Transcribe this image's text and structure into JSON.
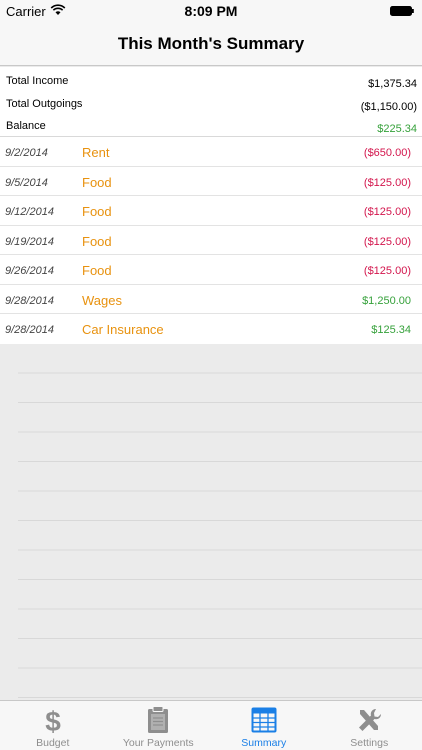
{
  "status_bar": {
    "carrier": "Carrier",
    "time": "8:09 PM"
  },
  "nav": {
    "title": "This Month's Summary"
  },
  "summary": {
    "rows": [
      {
        "label": "Total Income",
        "value": "$1,375.34",
        "color": "#000000"
      },
      {
        "label": "Total Outgoings",
        "value": "($1,150.00)",
        "color": "#000000"
      },
      {
        "label": "Balance",
        "value": "$225.34",
        "color": "#36a13b"
      }
    ]
  },
  "transactions": [
    {
      "date": "9/2/2014",
      "description": "Rent",
      "amount": "($650.00)",
      "type": "outgoing"
    },
    {
      "date": "9/5/2014",
      "description": "Food",
      "amount": "($125.00)",
      "type": "outgoing"
    },
    {
      "date": "9/12/2014",
      "description": "Food",
      "amount": "($125.00)",
      "type": "outgoing"
    },
    {
      "date": "9/19/2014",
      "description": "Food",
      "amount": "($125.00)",
      "type": "outgoing"
    },
    {
      "date": "9/26/2014",
      "description": "Food",
      "amount": "($125.00)",
      "type": "outgoing"
    },
    {
      "date": "9/28/2014",
      "description": "Wages",
      "amount": "$1,250.00",
      "type": "income"
    },
    {
      "date": "9/28/2014",
      "description": "Car Insurance",
      "amount": "$125.34",
      "type": "income"
    }
  ],
  "tabs": [
    {
      "label": "Budget",
      "icon": "dollar-icon",
      "active": false
    },
    {
      "label": "Your Payments",
      "icon": "clipboard-icon",
      "active": false
    },
    {
      "label": "Summary",
      "icon": "table-icon",
      "active": true
    },
    {
      "label": "Settings",
      "icon": "tools-icon",
      "active": false
    }
  ],
  "colors": {
    "accent": "#1a7fe6",
    "description": "#e8920f",
    "income": "#36a13b",
    "outgoing": "#d3164d"
  }
}
